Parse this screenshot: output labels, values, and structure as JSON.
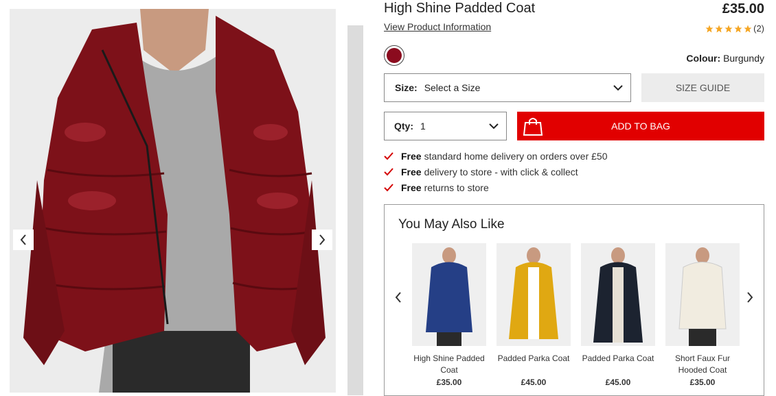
{
  "product": {
    "title": "High Shine Padded Coat",
    "price": "£35.00",
    "info_link": "View Product Information",
    "rating_count": "(2)",
    "stars": 5,
    "colour_label": "Colour:",
    "colour_value": "Burgundy",
    "colour_hex": "#8b0b1e"
  },
  "size": {
    "label": "Size:",
    "value": "Select a Size"
  },
  "size_guide": "SIZE GUIDE",
  "qty": {
    "label": "Qty:",
    "value": "1"
  },
  "add_to_bag": "ADD TO BAG",
  "perks": [
    {
      "bold": "Free",
      "text": "standard home delivery on orders over £50"
    },
    {
      "bold": "Free",
      "text": "delivery to store - with click & collect"
    },
    {
      "bold": "Free",
      "text": "returns to store"
    }
  ],
  "recommendations": {
    "title": "You May Also Like",
    "items": [
      {
        "name": "High Shine Padded Coat",
        "price": "£35.00",
        "color": "#253f86"
      },
      {
        "name": "Padded Parka Coat",
        "price": "£45.00",
        "color": "#e0a812"
      },
      {
        "name": "Padded Parka Coat",
        "price": "£45.00",
        "color": "#1c2330"
      },
      {
        "name": "Short Faux Fur Hooded Coat",
        "price": "£35.00",
        "color": "#f1ece0"
      }
    ]
  },
  "colors": {
    "accent_red": "#e10000",
    "tick_red": "#d40000",
    "star": "#f5a623"
  }
}
